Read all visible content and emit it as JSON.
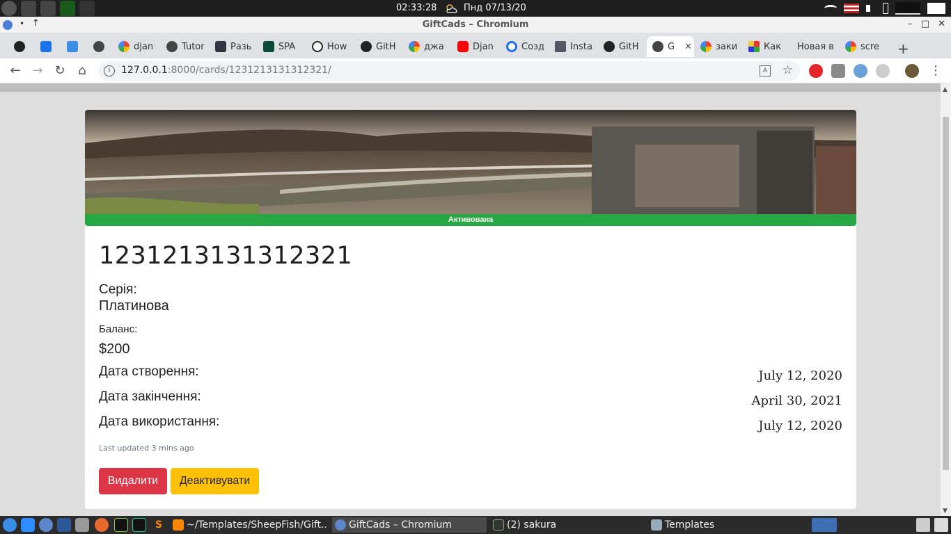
{
  "os": {
    "clock": "02:33:28",
    "date": "Пнд 07/13/20"
  },
  "window": {
    "title": "GiftCads – Chromium"
  },
  "tabs": [
    {
      "label": ""
    },
    {
      "label": ""
    },
    {
      "label": ""
    },
    {
      "label": ""
    },
    {
      "label": "djan"
    },
    {
      "label": "Tutor"
    },
    {
      "label": "Разь"
    },
    {
      "label": "SPA"
    },
    {
      "label": "How"
    },
    {
      "label": "GitH"
    },
    {
      "label": "джа"
    },
    {
      "label": "Djan"
    },
    {
      "label": "Созд"
    },
    {
      "label": "Insta"
    },
    {
      "label": "GitH"
    },
    {
      "label": "G"
    },
    {
      "label": "заки"
    },
    {
      "label": "Как"
    },
    {
      "label": "Новая в"
    },
    {
      "label": "scre"
    }
  ],
  "omnibox": {
    "host": "127.0.0.1",
    "rest": ":8000/cards/1231213131312321/"
  },
  "card": {
    "status": "Активована",
    "status_color": "#28a745",
    "number": "1231213131312321",
    "series_label": "Серія:",
    "series_value": "Платинова",
    "balance_label": "Баланс:",
    "balance_value": "$200",
    "created_label": "Дата створення:",
    "created_value": "July 12, 2020",
    "expires_label": "Дата закінчення:",
    "expires_value": "April 30, 2021",
    "used_label": "Дата використання:",
    "used_value": "July 12, 2020",
    "updated": "Last updated 3 mins ago",
    "delete_button": "Видалити",
    "deactivate_button": "Деактивувати"
  },
  "taskbar": {
    "tasks": [
      {
        "label": "~/Templates/SheepFish/Gift..."
      },
      {
        "label": "GiftCads – Chromium"
      },
      {
        "label": "(2) sakura"
      },
      {
        "label": "Templates"
      }
    ]
  }
}
